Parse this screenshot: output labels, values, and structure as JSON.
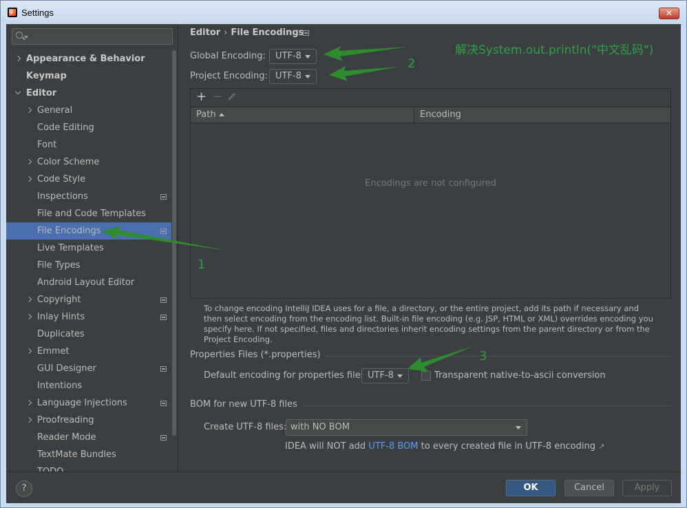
{
  "window": {
    "title": "Settings",
    "close_label": "✕"
  },
  "sidebar": {
    "search": {
      "value": ""
    },
    "items": [
      {
        "label": "Appearance & Behavior",
        "level": 0,
        "chevron": "right",
        "bold": true,
        "icon": false,
        "selected": false
      },
      {
        "label": "Keymap",
        "level": 0,
        "chevron": "none",
        "bold": true,
        "icon": false,
        "selected": false
      },
      {
        "label": "Editor",
        "level": 0,
        "chevron": "down",
        "bold": true,
        "icon": false,
        "selected": false
      },
      {
        "label": "General",
        "level": 1,
        "chevron": "right",
        "bold": false,
        "icon": false,
        "selected": false
      },
      {
        "label": "Code Editing",
        "level": 1,
        "chevron": "none",
        "bold": false,
        "icon": false,
        "selected": false
      },
      {
        "label": "Font",
        "level": 1,
        "chevron": "none",
        "bold": false,
        "icon": false,
        "selected": false
      },
      {
        "label": "Color Scheme",
        "level": 1,
        "chevron": "right",
        "bold": false,
        "icon": false,
        "selected": false
      },
      {
        "label": "Code Style",
        "level": 1,
        "chevron": "right",
        "bold": false,
        "icon": false,
        "selected": false
      },
      {
        "label": "Inspections",
        "level": 1,
        "chevron": "none",
        "bold": false,
        "icon": true,
        "selected": false
      },
      {
        "label": "File and Code Templates",
        "level": 1,
        "chevron": "none",
        "bold": false,
        "icon": false,
        "selected": false
      },
      {
        "label": "File Encodings",
        "level": 1,
        "chevron": "none",
        "bold": false,
        "icon": true,
        "selected": true
      },
      {
        "label": "Live Templates",
        "level": 1,
        "chevron": "none",
        "bold": false,
        "icon": false,
        "selected": false
      },
      {
        "label": "File Types",
        "level": 1,
        "chevron": "none",
        "bold": false,
        "icon": false,
        "selected": false
      },
      {
        "label": "Android Layout Editor",
        "level": 1,
        "chevron": "none",
        "bold": false,
        "icon": false,
        "selected": false
      },
      {
        "label": "Copyright",
        "level": 1,
        "chevron": "right",
        "bold": false,
        "icon": true,
        "selected": false
      },
      {
        "label": "Inlay Hints",
        "level": 1,
        "chevron": "right",
        "bold": false,
        "icon": true,
        "selected": false
      },
      {
        "label": "Duplicates",
        "level": 1,
        "chevron": "none",
        "bold": false,
        "icon": false,
        "selected": false
      },
      {
        "label": "Emmet",
        "level": 1,
        "chevron": "right",
        "bold": false,
        "icon": false,
        "selected": false
      },
      {
        "label": "GUI Designer",
        "level": 1,
        "chevron": "none",
        "bold": false,
        "icon": true,
        "selected": false
      },
      {
        "label": "Intentions",
        "level": 1,
        "chevron": "none",
        "bold": false,
        "icon": false,
        "selected": false
      },
      {
        "label": "Language Injections",
        "level": 1,
        "chevron": "right",
        "bold": false,
        "icon": true,
        "selected": false
      },
      {
        "label": "Proofreading",
        "level": 1,
        "chevron": "right",
        "bold": false,
        "icon": false,
        "selected": false
      },
      {
        "label": "Reader Mode",
        "level": 1,
        "chevron": "none",
        "bold": false,
        "icon": true,
        "selected": false
      },
      {
        "label": "TextMate Bundles",
        "level": 1,
        "chevron": "none",
        "bold": false,
        "icon": false,
        "selected": false
      },
      {
        "label": "TODO",
        "level": 1,
        "chevron": "none",
        "bold": false,
        "icon": false,
        "selected": false
      }
    ]
  },
  "breadcrumb": {
    "parent": "Editor",
    "separator": "›",
    "current": "File Encodings"
  },
  "global_encoding": {
    "label": "Global Encoding:",
    "value": "UTF-8"
  },
  "project_encoding": {
    "label": "Project Encoding:",
    "value": "UTF-8"
  },
  "table": {
    "add_label": "+",
    "remove_label": "−",
    "columns": [
      "Path",
      "Encoding"
    ],
    "empty_text": "Encodings are not configured"
  },
  "help_text": "To change encoding IntelliJ IDEA uses for a file, a directory, or the entire project, add its path if necessary and then select encoding from the encoding list. Built-in file encoding (e.g. JSP, HTML or XML) overrides encoding you specify here. If not specified, files and directories inherit encoding settings from the parent directory or from the Project Encoding.",
  "properties_section": {
    "title": "Properties Files (*.properties)",
    "default_label": "Default encoding for properties files:",
    "default_value": "UTF-8",
    "transparent_label": "Transparent native-to-ascii conversion",
    "transparent_checked": false
  },
  "bom_section": {
    "title": "BOM for new UTF-8 files",
    "create_label": "Create UTF-8 files:",
    "create_value": "with NO BOM",
    "note_prefix": "IDEA will NOT add",
    "note_link": "UTF-8 BOM",
    "note_suffix": "to every created file in UTF-8 encoding",
    "note_icon": "↗"
  },
  "footer": {
    "help_label": "?",
    "ok_label": "OK",
    "cancel_label": "Cancel",
    "apply_label": "Apply"
  },
  "annotations": {
    "heading": "解决System.out.println(\"中文乱码\")",
    "n1": "1",
    "n2": "2",
    "n3": "3",
    "color": "#2ea043"
  },
  "colors": {
    "selection": "#4b6eaf",
    "panel": "#3c3f41",
    "link": "#589df6",
    "ok": "#365880"
  }
}
